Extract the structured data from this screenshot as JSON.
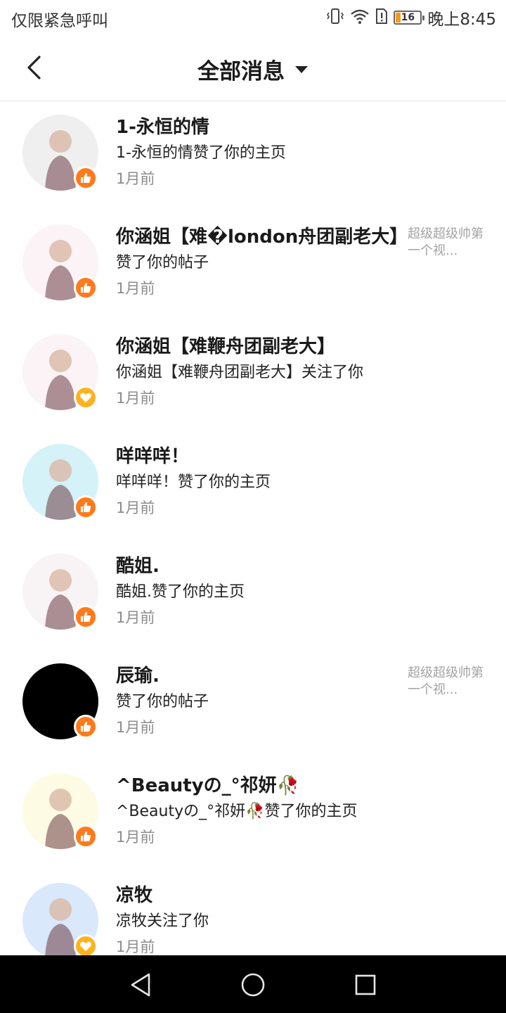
{
  "status_bar": {
    "carrier_text": "仅限紧急呼叫",
    "battery_level": "16",
    "time": "晚上8:45",
    "icons": [
      "vibrate-icon",
      "wifi-icon",
      "sim-alert-icon",
      "battery-icon"
    ]
  },
  "header": {
    "title": "全部消息",
    "back_icon": "chevron-left-icon",
    "dropdown_icon": "caret-down-icon"
  },
  "messages": [
    {
      "name": "1-永恒的情",
      "body": "1-永恒的情赞了你的主页",
      "time": "1月前",
      "badge": "like",
      "preview": "",
      "avatar_bg": "#efefef"
    },
    {
      "name": "你涵姐【难�london舟团副老大】",
      "body": "赞了你的帖子",
      "time": "1月前",
      "badge": "like",
      "preview": "超级超级帅第一个视...",
      "avatar_bg": "#fbf3f5"
    },
    {
      "name": "你涵姐【难鞭舟团副老大】",
      "body": "你涵姐【难鞭舟团副老大】关注了你",
      "time": "1月前",
      "badge": "follow",
      "preview": "",
      "avatar_bg": "#fbf3f5"
    },
    {
      "name": "咩咩咩！",
      "body": "咩咩咩！赞了你的主页",
      "time": "1月前",
      "badge": "like",
      "preview": "",
      "avatar_bg": "#d4f2f7"
    },
    {
      "name": "酷姐.",
      "body": "酷姐.赞了你的主页",
      "time": "1月前",
      "badge": "like",
      "preview": "",
      "avatar_bg": "#f8f4f6"
    },
    {
      "name": "辰瑜.",
      "body": "赞了你的帖子",
      "time": "1月前",
      "badge": "like",
      "preview": "超级超级帅第一个视...",
      "avatar_bg": "#000000"
    },
    {
      "name": "^Beautyの_°祁妍🥀",
      "body": "^Beautyの_°祁妍🥀赞了你的主页",
      "time": "1月前",
      "badge": "like",
      "preview": "",
      "avatar_bg": "#fdfbe3"
    },
    {
      "name": "凉牧",
      "body": "凉牧关注了你",
      "time": "1月前",
      "badge": "follow",
      "preview": "",
      "avatar_bg": "#d9e8fb"
    }
  ],
  "nav_bar": {
    "back_icon": "triangle-back-icon",
    "home_icon": "circle-home-icon",
    "recents_icon": "square-recents-icon"
  },
  "colors": {
    "like_badge": "#ff7a1a",
    "follow_badge": "#ffb21f",
    "time_text": "#8c8c8c",
    "preview_text": "#a3a3a3"
  }
}
